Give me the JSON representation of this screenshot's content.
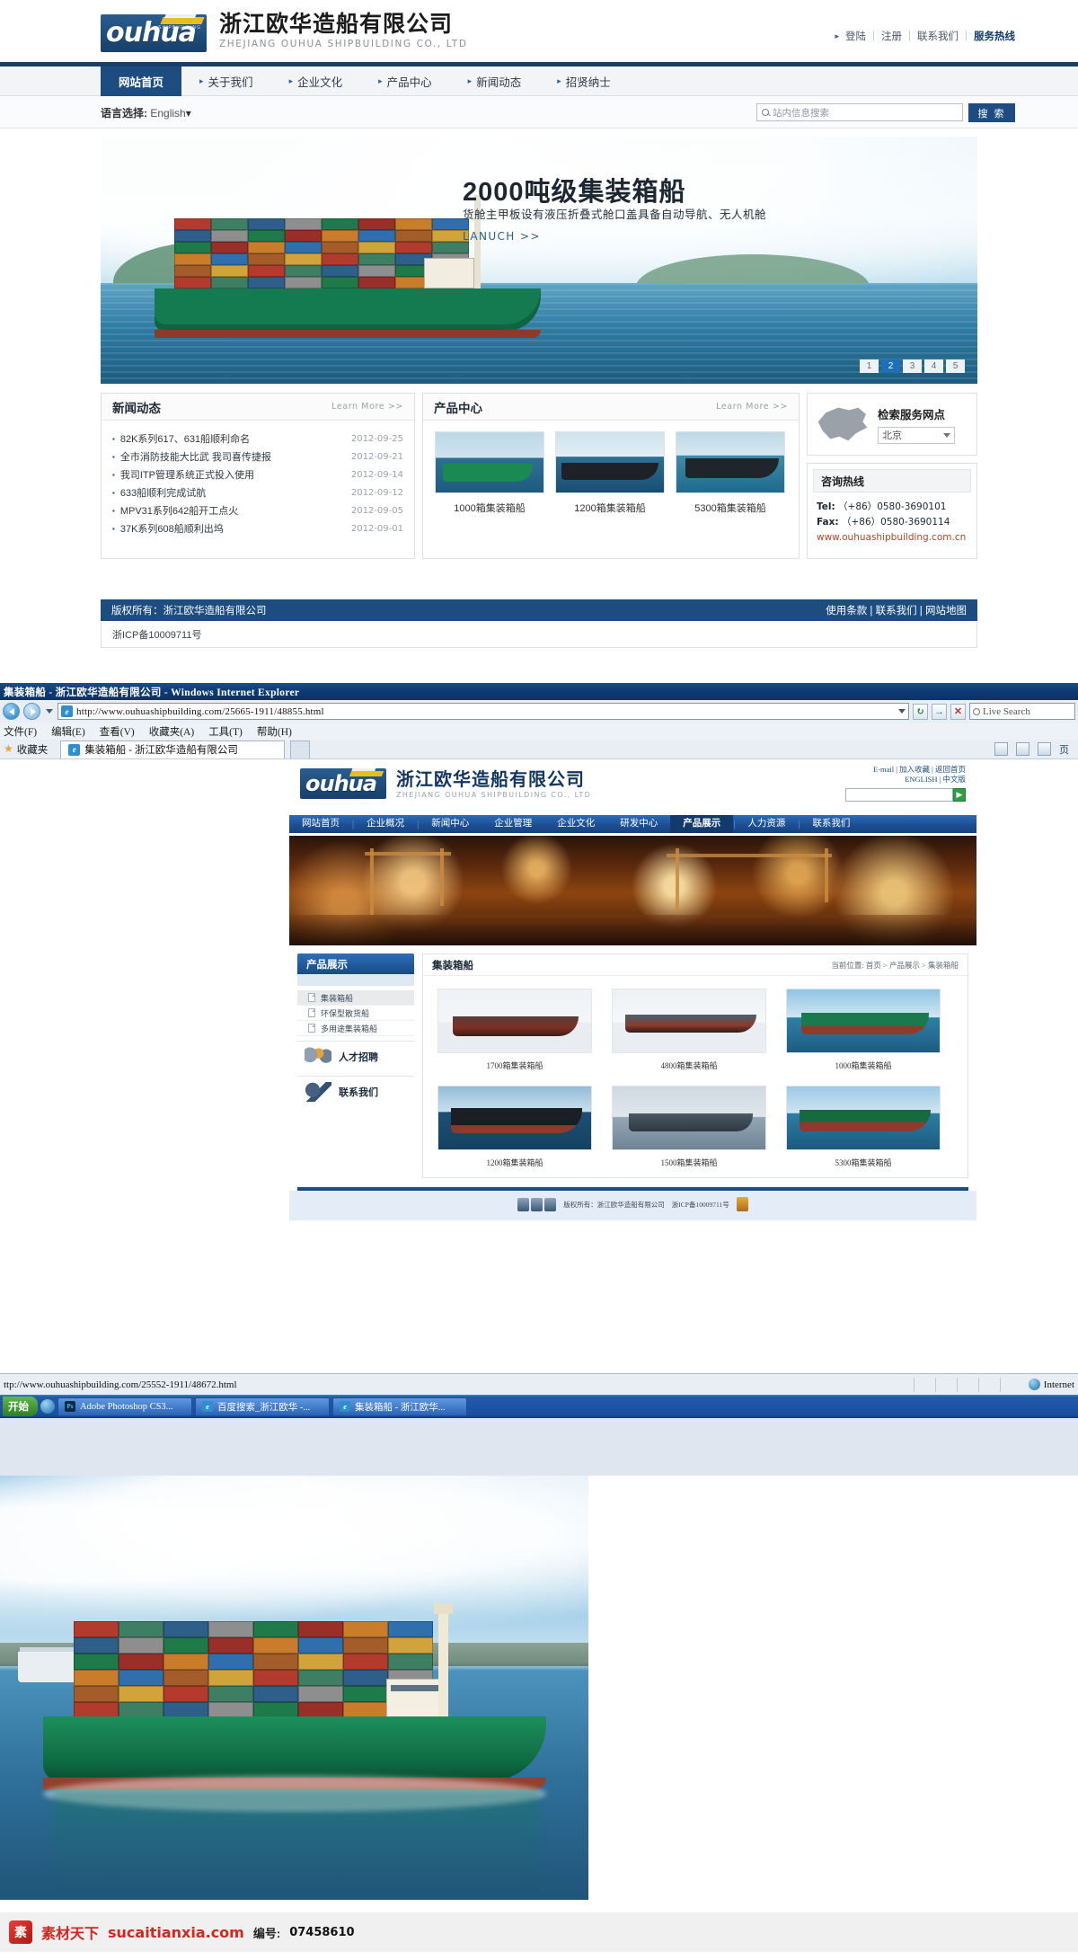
{
  "section1": {
    "brand": {
      "logo_text": "ouhua",
      "logo_tag": "SHIPBUILDING",
      "company_cn": "浙江欧华造船有限公司",
      "company_en": "ZHEJIANG OUHUA SHIPBUILDING CO., LTD"
    },
    "toplinks": {
      "login": "登陆",
      "register": "注册",
      "contact": "联系我们",
      "hotline": "服务热线"
    },
    "nav": [
      {
        "label": "网站首页",
        "active": true
      },
      {
        "label": "关于我们",
        "active": false
      },
      {
        "label": "企业文化",
        "active": false
      },
      {
        "label": "产品中心",
        "active": false
      },
      {
        "label": "新闻动态",
        "active": false
      },
      {
        "label": "招贤纳士",
        "active": false
      }
    ],
    "language": {
      "label": "语言选择:",
      "value": "English"
    },
    "search": {
      "placeholder": "站内信息搜索",
      "button": "搜 索"
    },
    "banner": {
      "title": "2000吨级集装箱船",
      "subtitle": "货舱主甲板设有液压折叠式舱口盖具备自动导航、无人机舱",
      "cta": "LANUCH >>",
      "pager": [
        "1",
        "2",
        "3",
        "4",
        "5"
      ],
      "active_page": "2"
    },
    "news": {
      "title": "新闻动态",
      "more": "Learn More >>",
      "items": [
        {
          "title": "82K系列617、631船顺利命名",
          "date": "2012-09-25"
        },
        {
          "title": "全市消防技能大比武 我司喜传捷报",
          "date": "2012-09-21"
        },
        {
          "title": "我司ITP管理系统正式投入使用",
          "date": "2012-09-14"
        },
        {
          "title": "633船顺利完成试航",
          "date": "2012-09-12"
        },
        {
          "title": "MPV31系列642船开工点火",
          "date": "2012-09-05"
        },
        {
          "title": "37K系列608船顺利出坞",
          "date": "2012-09-01"
        }
      ]
    },
    "products": {
      "title": "产品中心",
      "more": "Learn More >>",
      "items": [
        {
          "caption": "1000箱集装箱船"
        },
        {
          "caption": "1200箱集装箱船"
        },
        {
          "caption": "5300箱集装箱船"
        }
      ]
    },
    "service_locator": {
      "title": "检索服务网点",
      "selected_city": "北京"
    },
    "hotline": {
      "title": "咨询热线",
      "tel_label": "Tel:",
      "tel": "（+86）0580-3690101",
      "fax_label": "Fax:",
      "fax": "（+86）0580-3690114",
      "website": "www.ouhuashipbuilding.com.cn"
    },
    "footer": {
      "copyright": "版权所有：浙江欧华造船有限公司",
      "links": "使用条款 | 联系我们 | 网站地图",
      "icp": "浙ICP备10009711号"
    }
  },
  "section2": {
    "window_title": "集装箱船 - 浙江欧华造船有限公司 - Windows Internet Explorer",
    "address": "http://www.ouhuashipbuilding.com/25665-1911/48855.html",
    "search_placeholder": "Live Search",
    "menu": [
      "文件(F)",
      "编辑(E)",
      "查看(V)",
      "收藏夹(A)",
      "工具(T)",
      "帮助(H)"
    ],
    "favorites_label": "收藏夹",
    "tab_title": "集装箱船 - 浙江欧华造船有限公司",
    "tools_label": "页",
    "site": {
      "logo_text": "ouhua",
      "company_cn": "浙江欧华造船有限公司",
      "company_en": "ZHEJIANG OUHUA SHIPBUILDING CO., LTD",
      "utility_line1": "E-mail | 加入收藏 | 返回首页",
      "utility_line2": "ENGLISH | 中文版",
      "nav": [
        {
          "label": "网站首页",
          "active": false
        },
        {
          "label": "企业概况",
          "active": false
        },
        {
          "label": "新闻中心",
          "active": false
        },
        {
          "label": "企业管理",
          "active": false
        },
        {
          "label": "企业文化",
          "active": false
        },
        {
          "label": "研发中心",
          "active": false
        },
        {
          "label": "产品展示",
          "active": true
        },
        {
          "label": "人力资源",
          "active": false
        },
        {
          "label": "联系我们",
          "active": false
        }
      ],
      "sidebar": {
        "title": "产品展示",
        "items": [
          {
            "label": "集装箱船",
            "active": true
          },
          {
            "label": "环保型散货船",
            "active": false
          },
          {
            "label": "多用途集装箱船",
            "active": false
          }
        ],
        "blocks": [
          {
            "label": "人才招聘"
          },
          {
            "label": "联系我们"
          }
        ]
      },
      "content": {
        "heading": "集装箱船",
        "breadcrumb": "当前位置: 首页 > 产品展示 > 集装箱船",
        "items": [
          {
            "caption": "1700箱集装箱船"
          },
          {
            "caption": "4800箱集装箱船"
          },
          {
            "caption": "1000箱集装箱船"
          },
          {
            "caption": "1200箱集装箱船"
          },
          {
            "caption": "1500箱集装箱船"
          },
          {
            "caption": "5300箱集装箱船"
          }
        ]
      },
      "footer": {
        "copyright": "版权所有：浙江欧华造船有限公司",
        "icp": "浙ICP备10009711号"
      }
    },
    "status_url": "ttp://www.ouhuashipbuilding.com/25552-1911/48672.html",
    "status_zone": "Internet",
    "taskbar": {
      "start": "开始",
      "items": [
        {
          "label": "Adobe Photoshop CS3..."
        },
        {
          "label": "百度搜索_浙江欧华 -..."
        },
        {
          "label": "集装箱船 - 浙江欧华..."
        }
      ]
    }
  },
  "section3": {
    "watermark_brand": "素材天下",
    "watermark_site": "sucaitianxia.com",
    "code_label": "编号:",
    "code_value": "07458610"
  }
}
